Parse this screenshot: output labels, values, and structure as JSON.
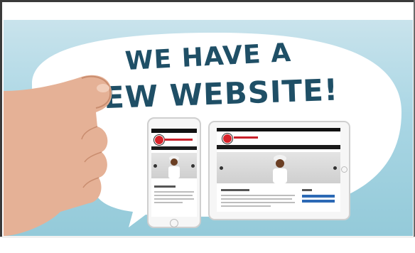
{
  "headline": {
    "line1": "WE HAVE A",
    "line2": "NEW WEBSITE!",
    "color": "#1f4f66"
  },
  "colors": {
    "background": "#a9d6e4",
    "bubble": "#ffffff",
    "brand_red": "#d8232a",
    "nav_dark": "#1b1b1b",
    "button_blue": "#2c69b5"
  },
  "icons": [
    "hand",
    "smartphone",
    "tablet",
    "logo"
  ]
}
